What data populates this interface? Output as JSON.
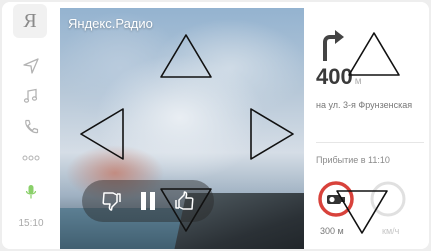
{
  "rail": {
    "logo_letter": "Я",
    "time": "15:10"
  },
  "player": {
    "title": "Яндекс.Радио",
    "controls": {
      "dislike_icon": "thumb-down-icon",
      "pause_icon": "pause-icon",
      "like_icon": "thumb-up-icon"
    }
  },
  "navigation": {
    "distance_value": "400",
    "distance_unit": "м",
    "street": "на ул. 3-я Фрунзенская",
    "arrival": "Прибытие в 11:10",
    "sign_distance": "300 м",
    "speed_label": "км/ч"
  },
  "colors": {
    "accent_red": "#d8423b",
    "rail_icon": "#b9b9b9"
  }
}
